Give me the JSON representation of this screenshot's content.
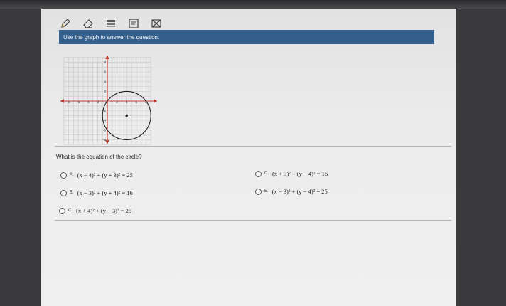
{
  "toolbar": {
    "icons": [
      "pencil-icon",
      "eraser-icon",
      "highlighter-icon",
      "notes-icon",
      "eliminate-icon"
    ]
  },
  "instructions": "Use the graph to answer the question.",
  "graph": {
    "x_ticks": [
      "-8",
      "-6",
      "-4",
      "-2",
      "2",
      "4",
      "6",
      "8"
    ],
    "y_ticks": [
      "8",
      "6",
      "4",
      "2",
      "-2",
      "-4",
      "-6",
      "-8"
    ],
    "circle": {
      "center": [
        4,
        -3
      ],
      "radius": 5
    },
    "colors": {
      "axes": "#c0392b",
      "circle": "#222222",
      "grid": "#c8c8c8"
    }
  },
  "question": "What is the equation of the circle?",
  "choices": [
    {
      "letter": "A.",
      "equation": "(x − 4)² + (y + 3)² = 25"
    },
    {
      "letter": "B.",
      "equation": "(x − 3)² + (y + 4)² = 16"
    },
    {
      "letter": "C.",
      "equation": "(x + 4)² + (y − 3)² = 25"
    },
    {
      "letter": "D.",
      "equation": "(x + 3)² + (y − 4)² = 16"
    },
    {
      "letter": "E.",
      "equation": "(x − 3)² + (y − 4)² = 25"
    }
  ]
}
